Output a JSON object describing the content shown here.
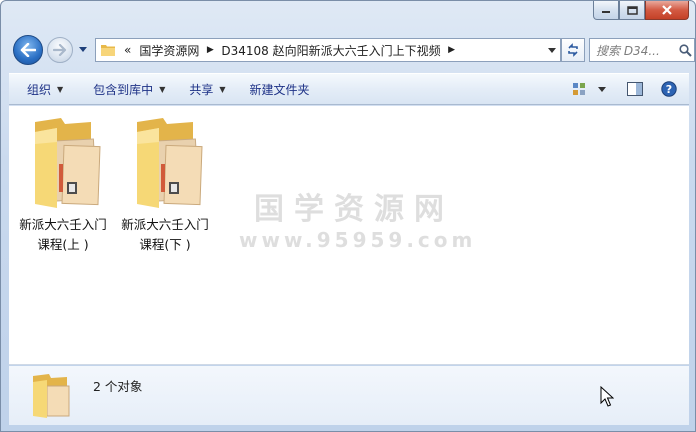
{
  "window": {
    "minimize_icon": "minimize-icon",
    "maximize_icon": "maximize-icon",
    "close_icon": "close-icon"
  },
  "nav": {
    "address": {
      "overflow": "«",
      "segments": [
        {
          "label": "国学资源网"
        },
        {
          "label": "D34108 赵向阳新派大六壬入门上下视频"
        }
      ]
    },
    "search": {
      "placeholder": "搜索 D34..."
    }
  },
  "toolbar": {
    "organize": "组织",
    "include_in_library": "包含到库中",
    "share": "共享",
    "new_folder": "新建文件夹"
  },
  "items": [
    {
      "line1": "新派大六壬入门",
      "line2": "课程(上 )"
    },
    {
      "line1": "新派大六壬入门",
      "line2": "课程(下 )"
    }
  ],
  "watermark": {
    "title": "国学资源网",
    "url": "www.95959.com"
  },
  "details": {
    "count": "2 个对象"
  },
  "colors": {
    "toolbar_text": "#1e3287",
    "accent": "#2a6fc4",
    "folder": "#f2c85b"
  }
}
